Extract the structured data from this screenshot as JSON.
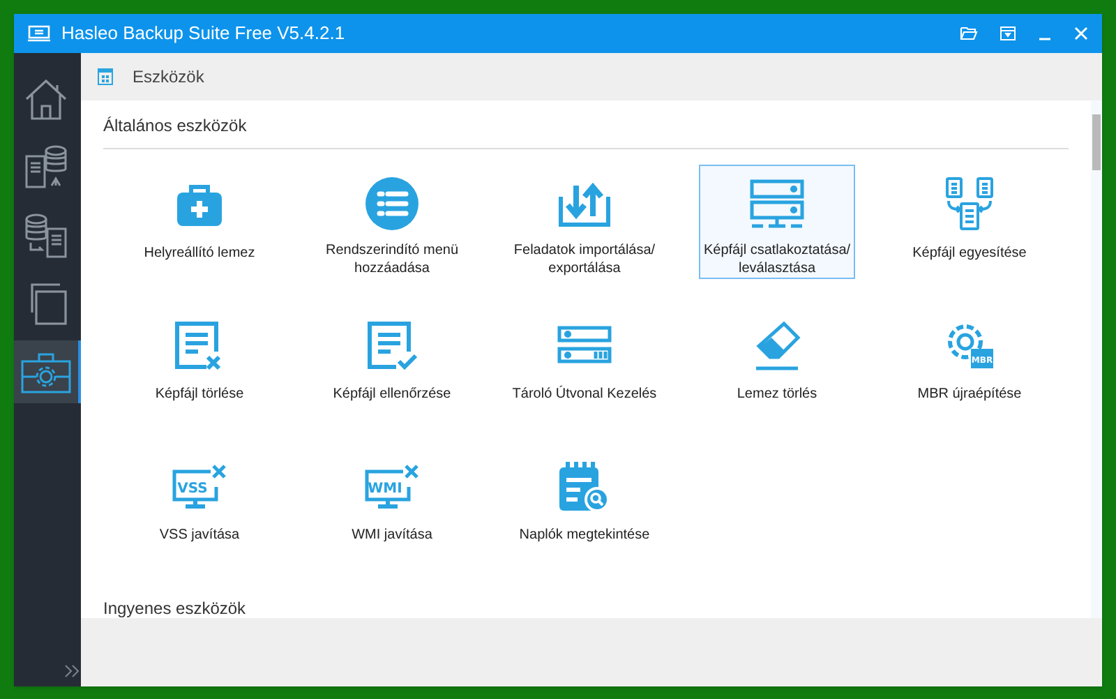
{
  "window": {
    "title": "Hasleo Backup Suite Free V5.4.2.1"
  },
  "sidebar": {
    "items": [
      {
        "selected": false
      },
      {
        "selected": false
      },
      {
        "selected": false
      },
      {
        "selected": false
      },
      {
        "selected": true
      }
    ]
  },
  "header": {
    "title": "Eszközök"
  },
  "sections": [
    {
      "title": "Általános eszközök",
      "tools": [
        {
          "label": "Helyreállító lemez",
          "selected": false
        },
        {
          "label": "Rendszerindító menü\nhozzáadása",
          "selected": false
        },
        {
          "label": "Feladatok importálása/\nexportálása",
          "selected": false
        },
        {
          "label": "Képfájl csatlakoztatása/\nleválasztása",
          "selected": true
        },
        {
          "label": "Képfájl egyesítése",
          "selected": false
        },
        {
          "label": "Képfájl törlése",
          "selected": false
        },
        {
          "label": "Képfájl ellenőrzése",
          "selected": false
        },
        {
          "label": "Tároló Útvonal Kezelés",
          "selected": false
        },
        {
          "label": "Lemez törlés",
          "selected": false
        },
        {
          "label": "MBR újraépítése",
          "icon_text": "MBR",
          "selected": false
        },
        {
          "label": "VSS javítása",
          "icon_text": "VSS",
          "selected": false
        },
        {
          "label": "WMI javítása",
          "icon_text": "WMI",
          "selected": false
        },
        {
          "label": "Naplók megtekintése",
          "selected": false
        }
      ]
    },
    {
      "title": "Ingyenes eszközök"
    }
  ]
}
